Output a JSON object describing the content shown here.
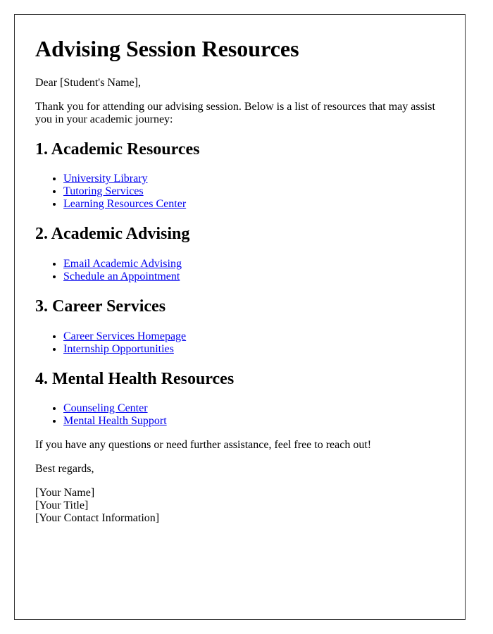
{
  "title": "Advising Session Resources",
  "greeting": "Dear [Student's Name],",
  "intro": "Thank you for attending our advising session. Below is a list of resources that may assist you in your academic journey:",
  "sections": [
    {
      "heading": "1. Academic Resources",
      "links": [
        "University Library",
        "Tutoring Services",
        "Learning Resources Center"
      ]
    },
    {
      "heading": "2. Academic Advising",
      "links": [
        "Email Academic Advising",
        "Schedule an Appointment"
      ]
    },
    {
      "heading": "3. Career Services",
      "links": [
        "Career Services Homepage",
        "Internship Opportunities"
      ]
    },
    {
      "heading": "4. Mental Health Resources",
      "links": [
        "Counseling Center",
        "Mental Health Support"
      ]
    }
  ],
  "closing_note": "If you have any questions or need further assistance, feel free to reach out!",
  "signoff": "Best regards,",
  "signature": {
    "name": "[Your Name]",
    "title": "[Your Title]",
    "contact": "[Your Contact Information]"
  },
  "colors": {
    "link": "#0000ee",
    "border": "#333333",
    "text": "#000000"
  }
}
